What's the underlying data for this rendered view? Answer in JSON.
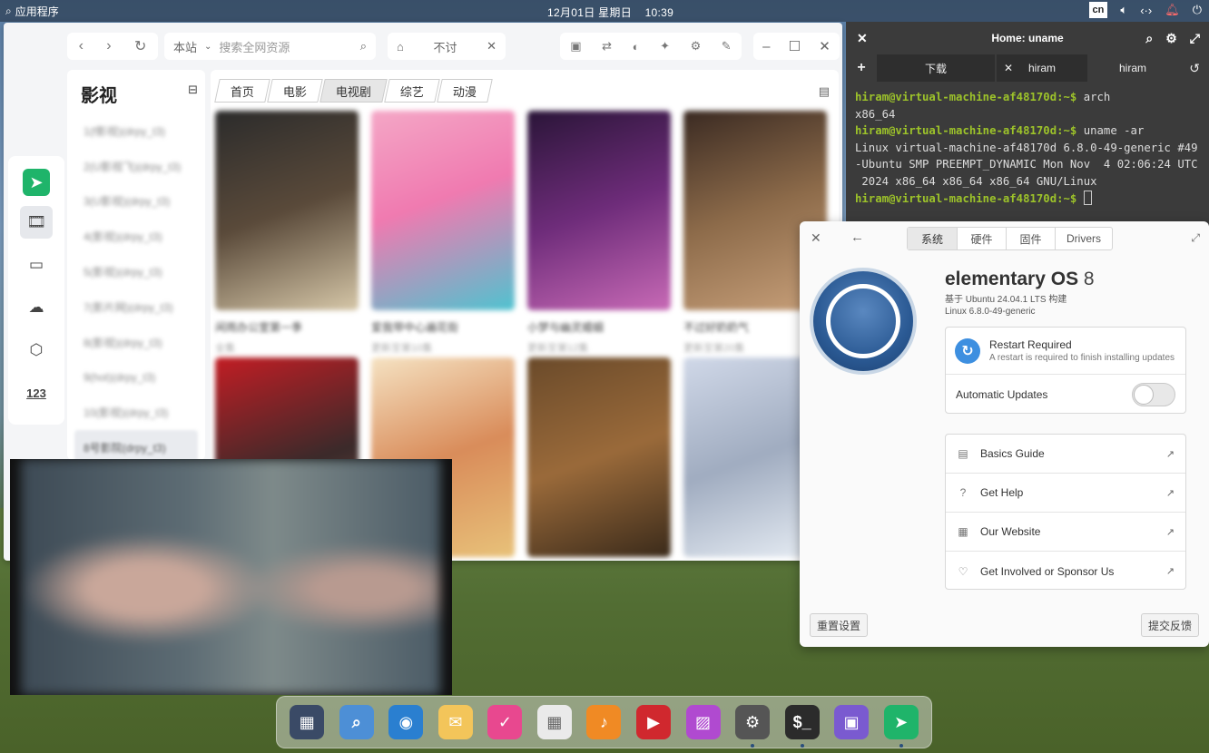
{
  "panel": {
    "apps_label": "应用程序",
    "clock": "12月01日 星期日    10:39",
    "lang": "cn"
  },
  "browser": {
    "search_site": "本站",
    "search_placeholder": "搜索全网资源",
    "tab_label": "不讨",
    "sidebar_title": "影视",
    "sites": [
      "1(f影视)(drpy_t3)",
      "2(U影视飞)(drpy_t3)",
      "3(U影视)(drpy_t3)",
      "4(影视)(drpy_t3)",
      "5(影视)(drpy_t3)",
      "7(影片网)(drpy_t3)",
      "8(影视)(drpy_t3)",
      "9(hot)(drpy_t3)",
      "10(影视)(drpy_t3)",
      "8号影院(drpy_t3)"
    ],
    "categories": [
      "首页",
      "电影",
      "电视剧",
      "综艺",
      "动漫"
    ],
    "cards": [
      {
        "title": "闲雨办公室第一季",
        "sub": "全集"
      },
      {
        "title": "爱我带中心遍花街",
        "sub": "更新至第10集"
      },
      {
        "title": "小梦与幽灵婚姻",
        "sub": "更新至第12集"
      },
      {
        "title": "不过好奶奶气",
        "sub": "更新至第20集"
      },
      {
        "title": "",
        "sub": ""
      },
      {
        "title": "",
        "sub": ""
      },
      {
        "title": "",
        "sub": ""
      },
      {
        "title": "",
        "sub": ""
      }
    ]
  },
  "terminal": {
    "title": "Home: uname",
    "tabs": [
      "下载",
      "hiram",
      "hiram"
    ],
    "lines": [
      {
        "prompt": "hiram@virtual-machine-af48170d:~$ ",
        "text": "arch"
      },
      {
        "prompt": "",
        "text": "x86_64"
      },
      {
        "prompt": "hiram@virtual-machine-af48170d:~$ ",
        "text": "uname -ar"
      },
      {
        "prompt": "",
        "text": "Linux virtual-machine-af48170d 6.8.0-49-generic #49"
      },
      {
        "prompt": "",
        "text": "-Ubuntu SMP PREEMPT_DYNAMIC Mon Nov  4 02:06:24 UTC"
      },
      {
        "prompt": "",
        "text": " 2024 x86_64 x86_64 x86_64 GNU/Linux"
      },
      {
        "prompt": "hiram@virtual-machine-af48170d:~$ ",
        "text": ""
      }
    ]
  },
  "about": {
    "tabs": [
      "系统",
      "硬件",
      "固件",
      "Drivers"
    ],
    "os_name": "elementary OS",
    "os_version": "8",
    "base": "基于 Ubuntu 24.04.1 LTS 构建",
    "kernel": "Linux 6.8.0-49-generic",
    "restart_title": "Restart Required",
    "restart_sub": "A restart is required to finish installing updates",
    "auto_updates": "Automatic Updates",
    "auto_updates_on": false,
    "links": [
      "Basics Guide",
      "Get Help",
      "Our Website",
      "Get Involved or Sponsor Us"
    ],
    "reset": "重置设置",
    "feedback": "提交反馈"
  },
  "dock": {
    "apps": [
      "multitasking-view",
      "files",
      "web-browser",
      "mail",
      "tasks",
      "calendar",
      "music",
      "videos",
      "photos",
      "system-settings",
      "terminal",
      "appcenter",
      "tvbox"
    ]
  }
}
